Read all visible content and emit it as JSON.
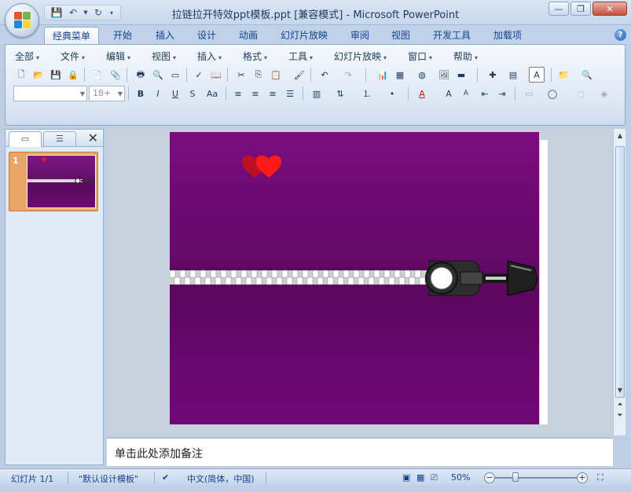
{
  "window": {
    "title": "拉链拉开特效ppt模板.ppt [兼容模式] - Microsoft PowerPoint",
    "minimize_icon": "minimize-icon",
    "maximize_icon": "restore-icon",
    "close_icon": "close-icon"
  },
  "quick_access": [
    "save-icon",
    "undo-icon",
    "redo-icon",
    "customize-icon"
  ],
  "tabs": [
    {
      "label": "经典菜单",
      "active": true
    },
    {
      "label": "开始"
    },
    {
      "label": "插入"
    },
    {
      "label": "设计"
    },
    {
      "label": "动画"
    },
    {
      "label": "幻灯片放映"
    },
    {
      "label": "审阅"
    },
    {
      "label": "视图"
    },
    {
      "label": "开发工具"
    },
    {
      "label": "加载项"
    }
  ],
  "menus": [
    "全部",
    "文件",
    "编辑",
    "视图",
    "插入",
    "格式",
    "工具",
    "幻灯片放映",
    "窗口",
    "帮助"
  ],
  "font": {
    "name": "",
    "size_placeholder": "18+"
  },
  "left_panel": {
    "tabs": [
      "slides-tab",
      "outline-tab"
    ],
    "slide_number": "1"
  },
  "notes": {
    "placeholder": "单击此处添加备注"
  },
  "status": {
    "slide_info": "幻灯片 1/1",
    "theme": "\"默认设计模板\"",
    "language": "中文(简体，中国)",
    "zoom": "50%"
  },
  "colors": {
    "slide_bg": "#6e0a74",
    "heart": "#ff1a1a",
    "accent": "#15428b"
  }
}
